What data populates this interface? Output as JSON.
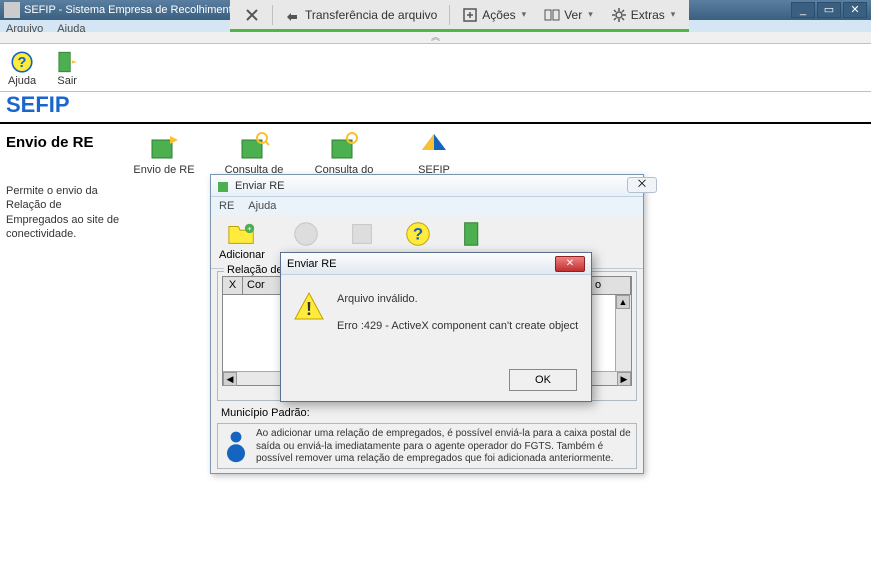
{
  "window": {
    "title": "SEFIP - Sistema Empresa de Recolhimento do FGTS",
    "titlebar_buttons": {
      "minimize": "_",
      "maximize": "▭",
      "close": "✕"
    }
  },
  "browser_toolbar": {
    "close_label": "",
    "transfer_label": "Transferência de arquivo",
    "actions_label": "Ações",
    "view_label": "Ver",
    "extras_label": "Extras"
  },
  "app_menu": {
    "arquivo": "Arquivo",
    "ajuda": "Ajuda"
  },
  "main_toolbar": {
    "ajuda": "Ajuda",
    "sair": "Sair"
  },
  "heading": "SEFIP",
  "section": {
    "title": "Envio de RE",
    "desc": "Permite o envio da Relação de Empregados ao site de conectividade."
  },
  "content_icons": {
    "envio": "Envio de RE",
    "consulta": "Consulta de RE",
    "consulta2": "Consulta do",
    "sefip": "SEFIP"
  },
  "enviare_window": {
    "title": "Enviar RE",
    "menu": {
      "re": "RE",
      "ajuda": "Ajuda"
    },
    "toolbar": {
      "adicionar": "Adicionar"
    },
    "group_label": "Relação de",
    "table_headers": {
      "x": "X",
      "cor": "Cor",
      "right": "o"
    },
    "municipio": "Município Padrão:",
    "info_text": "Ao adicionar uma relação de empregados, é possível enviá-la para a caixa postal de saída ou enviá-la imediatamente para o agente operador do FGTS. Também é possível remover uma relação de empregados que foi adicionada anteriormente.",
    "close_glyph": "⨉"
  },
  "error_dialog": {
    "title": "Enviar RE",
    "line1": "Arquivo inválido.",
    "line2": "Erro :429 - ActiveX component can't create object",
    "ok": "OK",
    "close_glyph": "✕"
  }
}
